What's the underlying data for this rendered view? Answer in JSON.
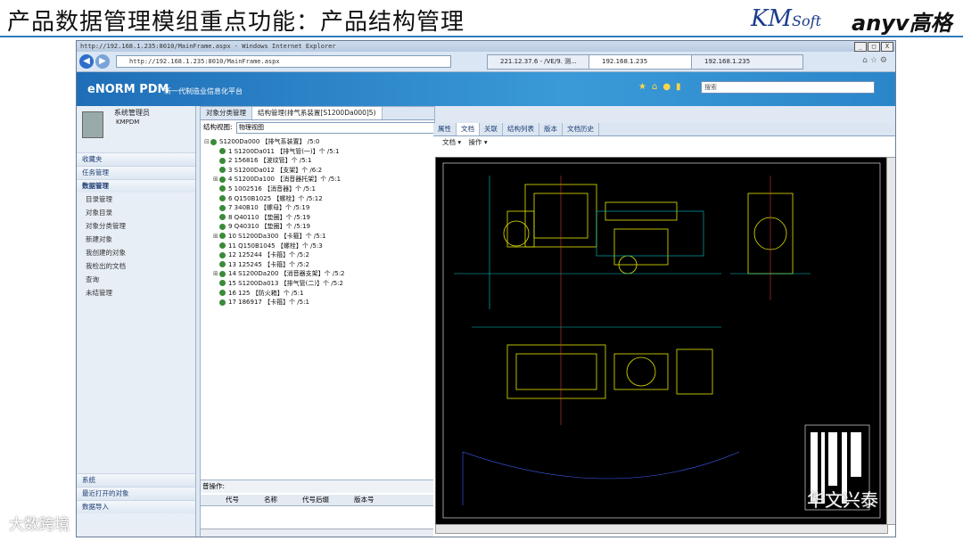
{
  "slide": {
    "title": "产品数据管理模组重点功能：产品结构管理",
    "logo_km": "KM",
    "logo_km_small": "Soft",
    "logo_anyv": "anyv高格"
  },
  "window": {
    "title": "http://192.168.1.235:8010/MainFrame.aspx - Windows Internet Explorer",
    "address": "http://192.168.1.235:8010/MainFrame.aspx",
    "tabs": [
      "221.12.37.6 - /VE/9. 测...",
      "192.168.1.235",
      "192.168.1.235"
    ],
    "min_label": "_",
    "max_label": "□",
    "close_label": "X"
  },
  "app": {
    "brand": "eNORM PDM",
    "brand_sub": "新一代制造业信息化平台",
    "search_placeholder": "搜索"
  },
  "user": {
    "name": "系统管理员",
    "id": "KMPDM"
  },
  "left_menu": {
    "favorites": "收藏夹",
    "tasks": "任务管理",
    "data": "数据管理",
    "data_items": [
      "目录管理",
      "对象目录",
      "对象分类管理",
      "新建对象",
      "我创建的对象",
      "我检出的文档",
      "查询",
      "未结管理"
    ],
    "bottom": [
      "系统",
      "最近打开的对象",
      "数据导入"
    ]
  },
  "middle": {
    "tabs": [
      "对象分类管理",
      "结构管理(排气系装置[S1200Da000]5)"
    ],
    "view_label": "结构视图:",
    "view_value": "物理视图",
    "tree": [
      {
        "t": "S1200Da000 【排气系装置】 /5:0",
        "lvl": 0,
        "pm": "⊟"
      },
      {
        "t": "1 S1200Da011 【排气管(一)】个 /5:1",
        "lvl": 1,
        "pm": ""
      },
      {
        "t": "2 156816 【波纹管】个 /5:1",
        "lvl": 1,
        "pm": ""
      },
      {
        "t": "3 S1200Da012 【支架】个 /6:2",
        "lvl": 1,
        "pm": ""
      },
      {
        "t": "4 S1200Da100 【消音器托架】个 /5:1",
        "lvl": 1,
        "pm": "⊞"
      },
      {
        "t": "5 1002516 【消音器】个 /5:1",
        "lvl": 1,
        "pm": ""
      },
      {
        "t": "6 Q150B1025 【螺栓】个 /5:12",
        "lvl": 1,
        "pm": ""
      },
      {
        "t": "7 340B10 【螺母】个 /5:19",
        "lvl": 1,
        "pm": ""
      },
      {
        "t": "8 Q40110 【垫圈】个 /5:19",
        "lvl": 1,
        "pm": ""
      },
      {
        "t": "9 Q40310 【垫圈】个 /5:19",
        "lvl": 1,
        "pm": ""
      },
      {
        "t": "10 S1200Da300 【卡箍】个 /5:1",
        "lvl": 1,
        "pm": "⊞"
      },
      {
        "t": "11 Q150B1045 【螺栓】个 /5:3",
        "lvl": 1,
        "pm": ""
      },
      {
        "t": "12 125244 【卡箍】个 /5:2",
        "lvl": 1,
        "pm": ""
      },
      {
        "t": "13 125245 【卡箍】个 /5:2",
        "lvl": 1,
        "pm": ""
      },
      {
        "t": "14 S1200Da200 【消音器支架】个 /5:2",
        "lvl": 1,
        "pm": "⊞"
      },
      {
        "t": "15 S1200Da013 【排气管(二)】个 /5:2",
        "lvl": 1,
        "pm": ""
      },
      {
        "t": "16 125 【防火箱】个 /5:1",
        "lvl": 1,
        "pm": ""
      },
      {
        "t": "17 186917 【卡箍】个 /5:1",
        "lvl": 1,
        "pm": ""
      }
    ],
    "ops_label": "普操作:",
    "op_columns": [
      "代号",
      "名称",
      "代号后缀",
      "版本号"
    ]
  },
  "right": {
    "tabs": [
      "属性",
      "文档",
      "关联",
      "结构列表",
      "版本",
      "文档历史"
    ],
    "toolbar_doc": "文档",
    "toolbar_op": "操作"
  },
  "watermarks": [
    "大数跨境",
    "华文兴泰"
  ],
  "colors": {
    "accent": "#2f7bbf",
    "banner": "#1f6eb7",
    "cad_yellow": "#e6e600",
    "cad_cyan": "#00c8c8"
  }
}
